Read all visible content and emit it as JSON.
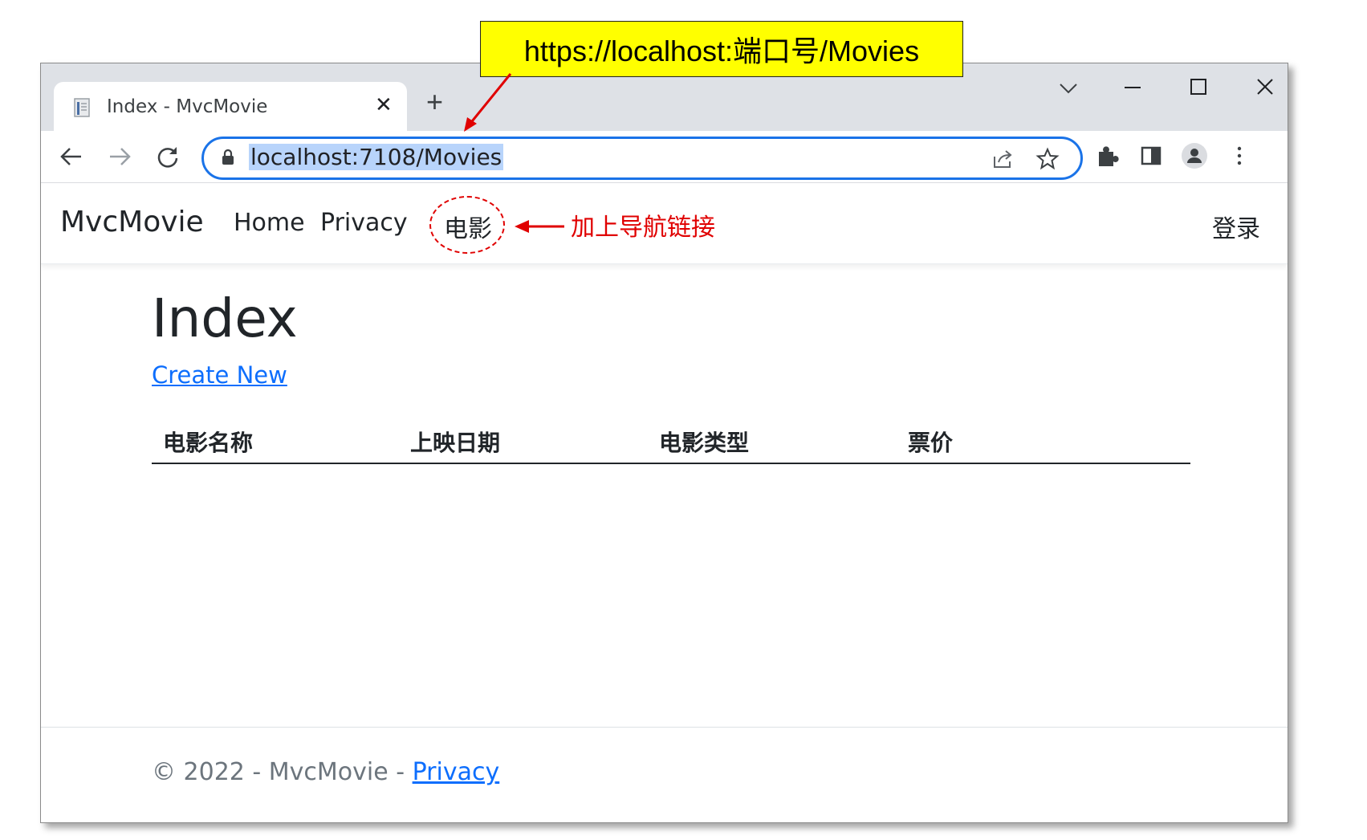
{
  "annotation": {
    "url_callout": "https://localhost:端口号/Movies",
    "nav_callout": "加上导航链接"
  },
  "tab": {
    "title": "Index - MvcMovie"
  },
  "omnibox": {
    "url": "localhost:7108/Movies"
  },
  "navbar": {
    "brand": "MvcMovie",
    "links": [
      "Home",
      "Privacy",
      "电影"
    ],
    "login": "登录"
  },
  "main": {
    "heading": "Index",
    "create_link": "Create New",
    "columns": [
      "电影名称",
      "上映日期",
      "电影类型",
      "票价"
    ]
  },
  "footer": {
    "text": "© 2022 - MvcMovie - ",
    "privacy_link": "Privacy"
  },
  "colors": {
    "accent": "#1a73e8",
    "link": "#0d6efd",
    "annotation_red": "#e00000",
    "callout_yellow": "#ffff00"
  }
}
